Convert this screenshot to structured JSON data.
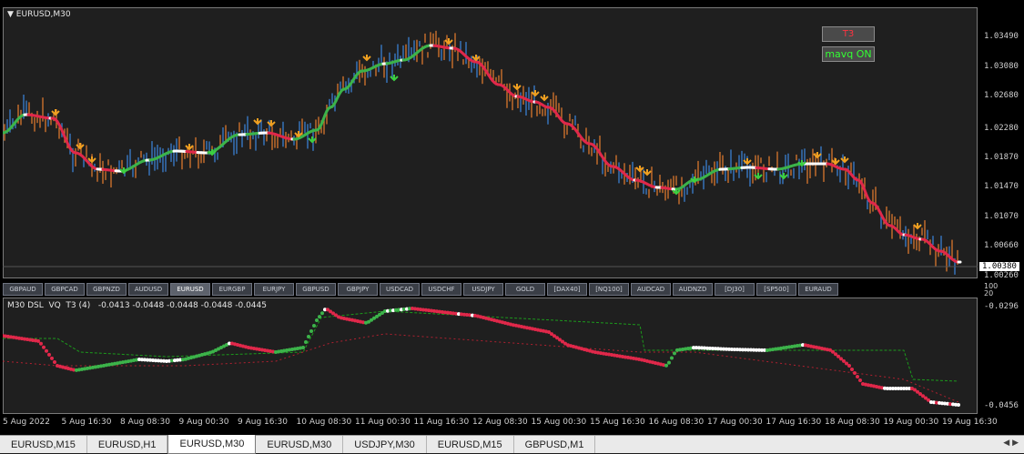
{
  "chart_header": {
    "title": "EURUSD,M30",
    "title_icon": "triangle-down-icon"
  },
  "buttons": {
    "t3": "T3",
    "mavq": "mavq ON"
  },
  "price_axis": {
    "labels": [
      "1.03490",
      "1.03080",
      "1.02680",
      "1.02280",
      "1.01870",
      "1.01470",
      "1.01070",
      "1.00660",
      "1.00260"
    ],
    "current_price": "1.00380"
  },
  "indicator": {
    "title": "M30 DSL  VQ  T3 (4)   -0.0413 -0.0448 -0.0448 -0.0448 -0.0445",
    "scale_top": "-0.0296",
    "scale_bottom": "-0.0456",
    "sep_top": "100",
    "sep_bottom": "20"
  },
  "symbols": [
    "GBPAUD",
    "GBPCAD",
    "GBPNZD",
    "AUDUSD",
    "EURUSD",
    "EURGBP",
    "EURJPY",
    "GBPUSD",
    "GBPJPY",
    "USDCAD",
    "USDCHF",
    "USDJPY",
    "GOLD",
    "[DAX40]",
    "[NQ100]",
    "AUDCAD",
    "AUDNZD",
    "[DJ30]",
    "[SP500]",
    "EURAUD"
  ],
  "active_symbol": "EURUSD",
  "time_axis": [
    "5 Aug 2022",
    "5 Aug 16:30",
    "8 Aug 08:30",
    "9 Aug 00:30",
    "9 Aug 16:30",
    "10 Aug 08:30",
    "11 Aug 00:30",
    "11 Aug 16:30",
    "12 Aug 08:30",
    "15 Aug 00:30",
    "15 Aug 16:30",
    "16 Aug 08:30",
    "17 Aug 00:30",
    "17 Aug 16:30",
    "18 Aug 08:30",
    "19 Aug 00:30",
    "19 Aug 16:30"
  ],
  "tabs": [
    "EURUSD,M15",
    "EURUSD,H1",
    "EURUSD,M30",
    "EURUSD,M30",
    "USDJPY,M30",
    "EURUSD,M15",
    "GBPUSD,M1"
  ],
  "active_tab_index": 2,
  "colors": {
    "bull": "#3a7fd0",
    "bear": "#d9772e",
    "ma_green": "#3cb34a",
    "ma_red": "#e0284a",
    "ma_white": "#ffffff",
    "arrow_orange": "#f0a020",
    "arrow_green": "#3cd040",
    "dsl_green": "#1c9a1c",
    "dsl_red": "#b02030"
  }
}
